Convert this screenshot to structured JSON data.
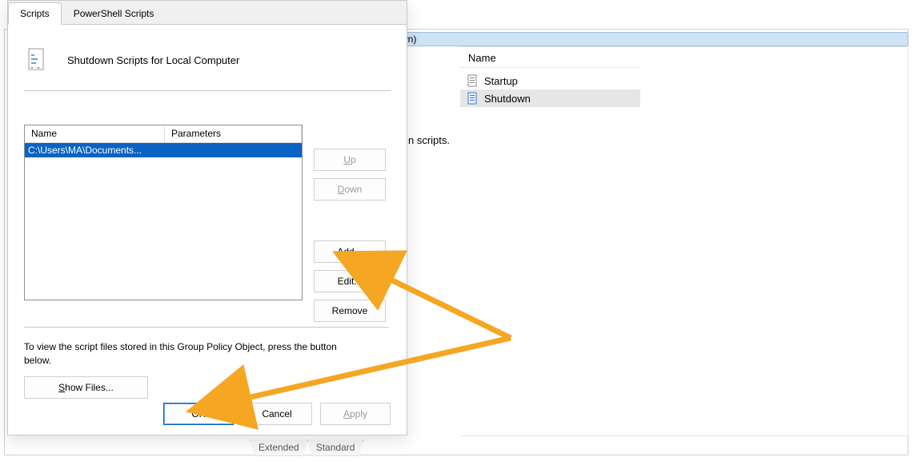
{
  "mmc": {
    "header_fragment": "wn)",
    "col_header": "Name",
    "rows": [
      {
        "label": "Startup",
        "selected": false
      },
      {
        "label": "Shutdown",
        "selected": true
      }
    ],
    "desc_fragment": "n scripts.",
    "bottom_tabs": [
      "Extended",
      "Standard"
    ]
  },
  "dialog": {
    "tabs": {
      "scripts": "Scripts",
      "ps": "PowerShell Scripts"
    },
    "title": "Shutdown Scripts for Local Computer",
    "columns": {
      "name": "Name",
      "params": "Parameters"
    },
    "entries": [
      {
        "name": "C:\\Users\\MA\\Documents...",
        "params": ""
      }
    ],
    "buttons": {
      "up": "Up",
      "down": "Down",
      "add": "Add...",
      "edit": "Edit...",
      "remove": "Remove",
      "show_files": "Show Files...",
      "ok": "OK",
      "cancel": "Cancel",
      "apply": "Apply"
    },
    "hint": "To view the script files stored in this Group Policy Object, press the button below."
  }
}
